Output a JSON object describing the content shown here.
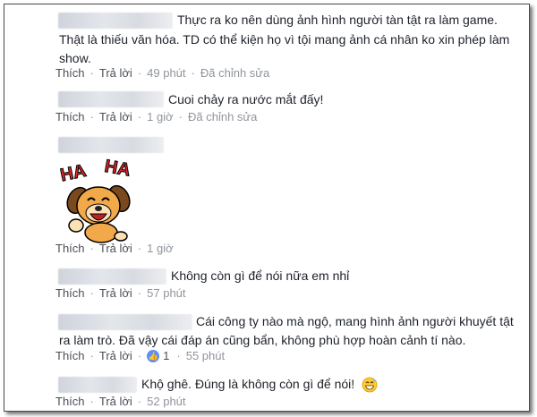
{
  "comments": [
    {
      "text_lines": [
        "Thực ra ko nên dùng ảnh hình người tàn tật ra làm game.",
        "Thật là thiếu văn hóa. TD có thể kiện họ vì tội mang ảnh cá nhân ko xin phép làm",
        "show."
      ],
      "like_label": "Thích",
      "reply_label": "Trả lời",
      "time": "49 phút",
      "edited": "Đã chỉnh sửa"
    },
    {
      "text_lines": [
        "Cuoi chảy ra nước mắt đấy!"
      ],
      "like_label": "Thích",
      "reply_label": "Trả lời",
      "time": "1 giờ",
      "edited": "Đã chỉnh sửa"
    },
    {
      "sticker": {
        "name": "haha-dog-sticker",
        "text": "HA HA"
      },
      "like_label": "Thích",
      "reply_label": "Trả lời",
      "time": "1 giờ"
    },
    {
      "text_lines": [
        "Không còn gì để nói nữa em nhỉ"
      ],
      "like_label": "Thích",
      "reply_label": "Trả lời",
      "time": "57 phút"
    },
    {
      "text_lines": [
        "Cái công ty nào mà ngộ, mang hình ảnh người khuyết tật",
        "ra làm trò. Đã vậy cái đáp án cũng bẩn, không phù hợp hoàn cảnh tí nào."
      ],
      "like_label": "Thích",
      "reply_label": "Trả lời",
      "like_count": "1",
      "time": "55 phút"
    },
    {
      "text_lines": [
        "Khộ ghê. Đúng là không còn gì để nói!"
      ],
      "emoji": "grinning-sweat-emoji",
      "like_label": "Thích",
      "reply_label": "Trả lời",
      "time": "52 phút"
    }
  ],
  "colors": {
    "text": "#1d2129",
    "action": "#4b4f56",
    "meta": "#90949c",
    "like_badge": "#5890ff"
  }
}
